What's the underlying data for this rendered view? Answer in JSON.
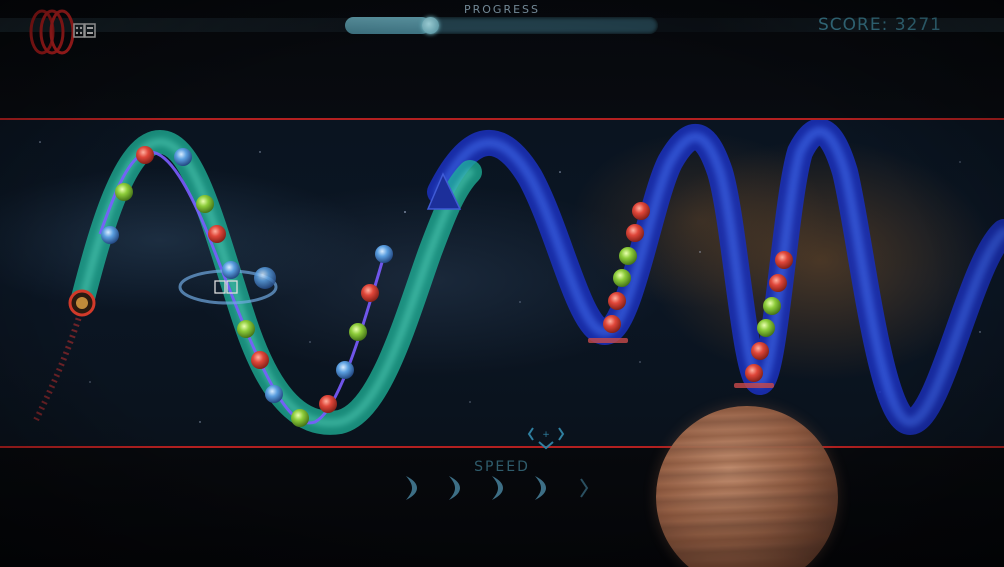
{
  "hud": {
    "lives_count": 3,
    "lives_counter": "",
    "progress_label": "PROGRESS",
    "progress": 0.27,
    "score_text": "SCORE: 3271"
  },
  "speed": {
    "label": "SPEED",
    "level": 4,
    "max": 5
  },
  "colors": {
    "boundary": "#b32020",
    "track_green": "#1fb49a",
    "track_blue": "#1a2fb5",
    "red_orb": "#e0473a",
    "blue_orb": "#5b9fe0",
    "green_orb": "#8dcc3a",
    "hud_text": "#3c7e92"
  },
  "icons": [
    "lives-rings-icon",
    "dice-counter-icon",
    "player-ship-icon",
    "arrow-marker-icon",
    "speed-chevron-icon",
    "center-marker-icon"
  ]
}
